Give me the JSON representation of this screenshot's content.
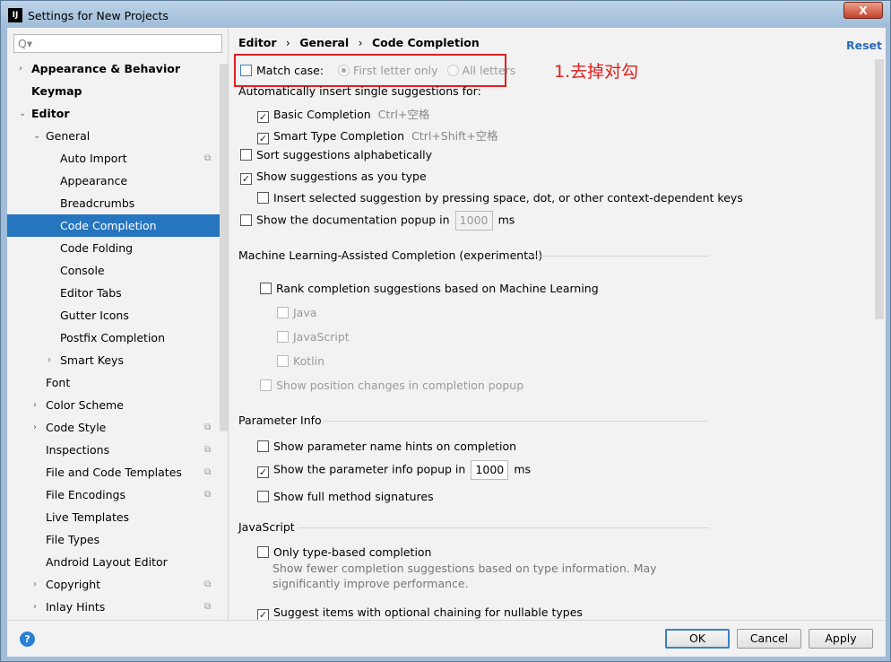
{
  "window": {
    "title": "Settings for New Projects",
    "close": "X",
    "logo": "IJ"
  },
  "search": {
    "placeholder": "Q▾"
  },
  "tree": [
    {
      "label": "Appearance & Behavior",
      "level": 0,
      "arrow": "›",
      "bold": true
    },
    {
      "label": "Keymap",
      "level": 0,
      "bold": true
    },
    {
      "label": "Editor",
      "level": 0,
      "arrow": "⌄",
      "bold": true
    },
    {
      "label": "General",
      "level": 1,
      "arrow": "⌄"
    },
    {
      "label": "Auto Import",
      "level": 2,
      "copy": true
    },
    {
      "label": "Appearance",
      "level": 2
    },
    {
      "label": "Breadcrumbs",
      "level": 2
    },
    {
      "label": "Code Completion",
      "level": 2,
      "selected": true
    },
    {
      "label": "Code Folding",
      "level": 2
    },
    {
      "label": "Console",
      "level": 2
    },
    {
      "label": "Editor Tabs",
      "level": 2
    },
    {
      "label": "Gutter Icons",
      "level": 2
    },
    {
      "label": "Postfix Completion",
      "level": 2
    },
    {
      "label": "Smart Keys",
      "level": 2,
      "arrow": "›"
    },
    {
      "label": "Font",
      "level": 1
    },
    {
      "label": "Color Scheme",
      "level": 1,
      "arrow": "›"
    },
    {
      "label": "Code Style",
      "level": 1,
      "arrow": "›",
      "copy": true
    },
    {
      "label": "Inspections",
      "level": 1,
      "copy": true
    },
    {
      "label": "File and Code Templates",
      "level": 1,
      "copy": true
    },
    {
      "label": "File Encodings",
      "level": 1,
      "copy": true
    },
    {
      "label": "Live Templates",
      "level": 1
    },
    {
      "label": "File Types",
      "level": 1
    },
    {
      "label": "Android Layout Editor",
      "level": 1
    },
    {
      "label": "Copyright",
      "level": 1,
      "arrow": "›",
      "copy": true
    },
    {
      "label": "Inlay Hints",
      "level": 1,
      "arrow": "›",
      "copy": true
    }
  ],
  "breadcrumb": {
    "a": "Editor",
    "b": "General",
    "c": "Code Completion",
    "sep": "›"
  },
  "reset": "Reset",
  "annotation": "1.去掉对勾",
  "match_case": {
    "label": "Match case:",
    "checked": false,
    "opt1": "First letter only",
    "opt2": "All letters"
  },
  "auto_insert": {
    "label": "Automatically insert single suggestions for:",
    "basic": "Basic Completion",
    "basic_key": "Ctrl+空格",
    "smart": "Smart Type Completion",
    "smart_key": "Ctrl+Shift+空格"
  },
  "sort": "Sort suggestions alphabetically",
  "show_as_type": "Show suggestions as you type",
  "insert_selected": "Insert selected suggestion by pressing space, dot, or other context-dependent keys",
  "doc_popup": {
    "label": "Show the documentation popup in",
    "value": "1000",
    "unit": "ms"
  },
  "ml": {
    "title": "Machine Learning-Assisted Completion (experimental)",
    "rank": "Rank completion suggestions based on Machine Learning",
    "java": "Java",
    "js": "JavaScript",
    "kotlin": "Kotlin",
    "positions": "Show position changes in completion popup"
  },
  "param": {
    "title": "Parameter Info",
    "hints": "Show parameter name hints on completion",
    "popup": "Show the parameter info popup in",
    "value": "1000",
    "unit": "ms",
    "full": "Show full method signatures"
  },
  "js": {
    "title": "JavaScript",
    "type_based": "Only type-based completion",
    "desc1": "Show fewer completion suggestions based on type information. May",
    "desc2": "significantly improve performance.",
    "optional": "Suggest items with optional chaining for nullable types"
  },
  "footer": {
    "help": "?",
    "ok": "OK",
    "cancel": "Cancel",
    "apply": "Apply"
  }
}
